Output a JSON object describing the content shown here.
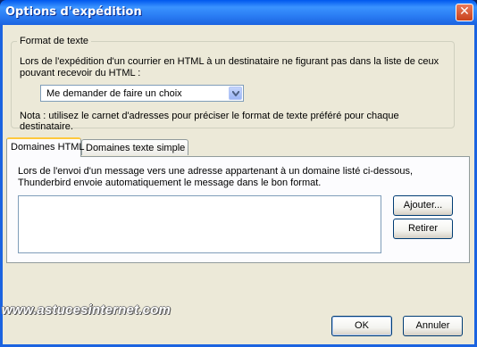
{
  "window": {
    "title": "Options d'expédition",
    "close_label": "✕"
  },
  "format": {
    "legend": "Format de texte",
    "description": "Lors de l'expédition d'un courrier en HTML à un destinataire ne figurant pas dans la liste de ceux pouvant recevoir du HTML :",
    "select_value": "Me demander de faire un choix",
    "note": "Nota : utilisez le carnet d'adresses pour préciser le format de texte préféré pour chaque destinataire."
  },
  "tabs": [
    {
      "label": "Domaines HTML",
      "active": true
    },
    {
      "label": "Domaines texte simple",
      "active": false
    }
  ],
  "panel": {
    "description": "Lors de l'envoi d'un message vers une adresse appartenant à un domaine listé ci-dessous, Thunderbird envoie automatiquement le message dans le bon format.",
    "domains": [],
    "add_label": "Ajouter...",
    "remove_label": "Retirer"
  },
  "footer": {
    "ok_label": "OK",
    "cancel_label": "Annuler"
  },
  "watermark": "www.astucesinternet.com"
}
